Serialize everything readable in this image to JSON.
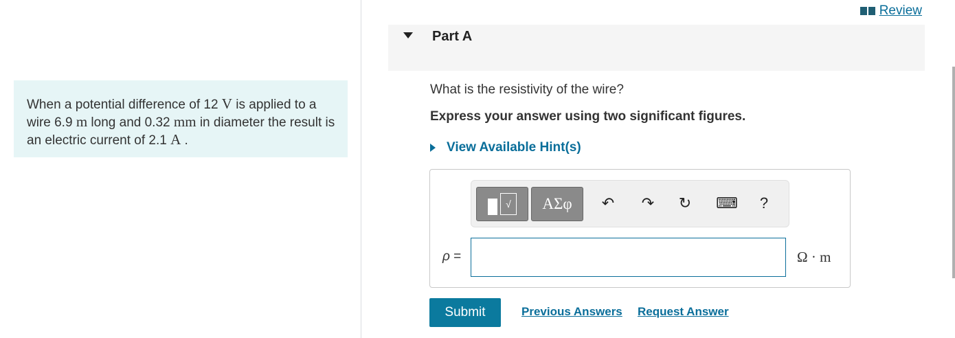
{
  "problem": {
    "text_1": "When a potential difference of 12 ",
    "unit_v": "V",
    "text_2": " is applied to a wire 6.9 ",
    "unit_m": "m",
    "text_3": " long and 0.32 ",
    "unit_mm": "mm",
    "text_4": " in diameter the result is an electric current of 2.1 ",
    "unit_a": "A",
    "text_5": " ."
  },
  "review": {
    "label": "Review"
  },
  "part": {
    "title": "Part A"
  },
  "question": {
    "prompt": "What is the resistivity of the wire?",
    "instruction": "Express your answer using two significant figures.",
    "hint_label": "View Available Hint(s)"
  },
  "toolbar": {
    "template_icon_text": "√",
    "greek_label": "ΑΣφ",
    "undo_icon": "↶",
    "redo_icon": "↷",
    "reset_icon": "↻",
    "keyboard_icon": "⌨",
    "help_label": "?"
  },
  "answer": {
    "variable": "ρ",
    "equals": "=",
    "value": "",
    "unit": "Ω · m"
  },
  "actions": {
    "submit": "Submit",
    "previous_answers": "Previous Answers",
    "request_answer": "Request Answer"
  }
}
